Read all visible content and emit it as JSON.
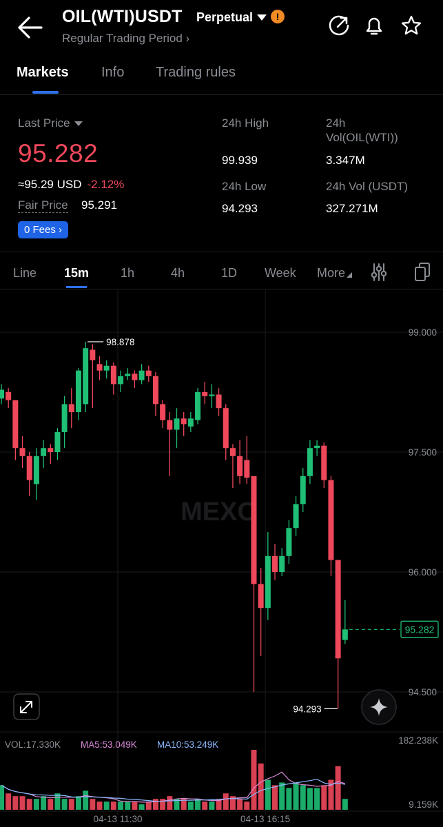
{
  "header": {
    "title": "OIL(WTI)USDT",
    "contract_type": "Perpetual",
    "warning_symbol": "!",
    "subtitle": "Regular Trading Period ›"
  },
  "tabs": [
    "Markets",
    "Info",
    "Trading rules"
  ],
  "stats": {
    "last_price_label": "Last Price",
    "last_price": "95.282",
    "approx_usd": "≈95.29 USD",
    "change_pct": "-2.12%",
    "fair_price_label": "Fair Price",
    "fair_price": "95.291",
    "fees_label": "0 Fees ›",
    "high_label": "24h High",
    "high": "99.939",
    "low_label": "24h Low",
    "low": "94.293",
    "vol_base_label_1": "24h",
    "vol_base_label_2": "Vol(OIL(WTI))",
    "vol_base": "3.347M",
    "vol_usdt_label": "24h Vol (USDT)",
    "vol_usdt": "327.271M"
  },
  "intervals": [
    "Line",
    "15m",
    "1h",
    "4h",
    "1D",
    "Week",
    "More"
  ],
  "colors": {
    "up": "#1fbf75",
    "down": "#f0485b",
    "accent": "#2f6fe8",
    "ma5": "#d98ad8",
    "ma10": "#8ab8ff"
  },
  "chart_data": {
    "type": "candlestick",
    "watermark": "MEXC",
    "price_axis": [
      "99.000",
      "97.500",
      "96.000",
      "94.500"
    ],
    "ylim": [
      93.6,
      99.6
    ],
    "current_price": "95.282",
    "max_label": "98.878",
    "min_label": "94.293",
    "time_labels": [
      "04-13 11:30",
      "04-13 16:15"
    ],
    "volume": {
      "label": "VOL:17.330K",
      "ma5_label": "MA5:53.049K",
      "ma10_label": "MA10:53.249K",
      "max_label": "182.238K",
      "min_label": "9.159K"
    },
    "candles": [
      {
        "o": 98.17,
        "c": 98.28,
        "h": 98.35,
        "l": 98.1
      },
      {
        "o": 98.25,
        "c": 98.15,
        "h": 98.3,
        "l": 98.05
      },
      {
        "o": 98.15,
        "c": 97.55,
        "h": 98.15,
        "l": 97.4
      },
      {
        "o": 97.55,
        "c": 97.45,
        "h": 97.7,
        "l": 97.3
      },
      {
        "o": 97.45,
        "c": 97.15,
        "h": 97.5,
        "l": 96.95
      },
      {
        "o": 97.1,
        "c": 97.45,
        "h": 97.55,
        "l": 96.9
      },
      {
        "o": 97.45,
        "c": 97.55,
        "h": 97.65,
        "l": 97.3
      },
      {
        "o": 97.55,
        "c": 97.5,
        "h": 97.6,
        "l": 97.35
      },
      {
        "o": 97.5,
        "c": 97.75,
        "h": 97.8,
        "l": 97.4
      },
      {
        "o": 97.75,
        "c": 98.1,
        "h": 98.2,
        "l": 97.55
      },
      {
        "o": 98.1,
        "c": 98.0,
        "h": 98.3,
        "l": 97.8
      },
      {
        "o": 98.0,
        "c": 98.52,
        "h": 98.55,
        "l": 97.9
      },
      {
        "o": 98.1,
        "c": 98.8,
        "h": 98.88,
        "l": 98.0
      },
      {
        "o": 98.78,
        "c": 98.65,
        "h": 98.85,
        "l": 98.05
      },
      {
        "o": 98.6,
        "c": 98.52,
        "h": 98.7,
        "l": 98.4
      },
      {
        "o": 98.52,
        "c": 98.58,
        "h": 98.65,
        "l": 98.42
      },
      {
        "o": 98.58,
        "c": 98.35,
        "h": 98.62,
        "l": 98.22
      },
      {
        "o": 98.35,
        "c": 98.45,
        "h": 98.52,
        "l": 98.25
      },
      {
        "o": 98.45,
        "c": 98.48,
        "h": 98.55,
        "l": 98.4
      },
      {
        "o": 98.48,
        "c": 98.4,
        "h": 98.52,
        "l": 98.3
      },
      {
        "o": 98.4,
        "c": 98.52,
        "h": 98.6,
        "l": 98.35
      },
      {
        "o": 98.52,
        "c": 98.45,
        "h": 98.58,
        "l": 98.38
      },
      {
        "o": 98.45,
        "c": 98.1,
        "h": 98.5,
        "l": 97.95
      },
      {
        "o": 98.1,
        "c": 97.9,
        "h": 98.15,
        "l": 97.8
      },
      {
        "o": 97.9,
        "c": 97.78,
        "h": 98.0,
        "l": 97.2
      },
      {
        "o": 97.78,
        "c": 97.92,
        "h": 98.05,
        "l": 97.55
      },
      {
        "o": 97.92,
        "c": 97.85,
        "h": 98.0,
        "l": 97.7
      },
      {
        "o": 97.82,
        "c": 97.92,
        "h": 98.0,
        "l": 97.75
      },
      {
        "o": 97.9,
        "c": 98.25,
        "h": 98.3,
        "l": 97.85
      },
      {
        "o": 98.25,
        "c": 98.2,
        "h": 98.38,
        "l": 98.1
      },
      {
        "o": 98.2,
        "c": 98.22,
        "h": 98.35,
        "l": 98.05
      },
      {
        "o": 98.22,
        "c": 98.05,
        "h": 98.3,
        "l": 97.95
      },
      {
        "o": 98.05,
        "c": 97.55,
        "h": 98.1,
        "l": 97.4
      },
      {
        "o": 97.55,
        "c": 97.45,
        "h": 97.6,
        "l": 97.05
      },
      {
        "o": 97.45,
        "c": 97.2,
        "h": 97.65,
        "l": 97.1
      },
      {
        "o": 97.4,
        "c": 97.18,
        "h": 97.7,
        "l": 97.1
      },
      {
        "o": 97.2,
        "c": 95.85,
        "h": 97.2,
        "l": 94.5
      },
      {
        "o": 95.85,
        "c": 95.55,
        "h": 96.05,
        "l": 94.95
      },
      {
        "o": 95.55,
        "c": 96.2,
        "h": 96.5,
        "l": 95.4
      },
      {
        "o": 96.2,
        "c": 96.0,
        "h": 96.35,
        "l": 95.9
      },
      {
        "o": 96.0,
        "c": 96.2,
        "h": 96.3,
        "l": 95.95
      },
      {
        "o": 96.2,
        "c": 96.55,
        "h": 96.65,
        "l": 96.1
      },
      {
        "o": 96.55,
        "c": 96.85,
        "h": 96.95,
        "l": 96.45
      },
      {
        "o": 96.85,
        "c": 97.2,
        "h": 97.3,
        "l": 96.75
      },
      {
        "o": 97.2,
        "c": 97.55,
        "h": 97.65,
        "l": 97.1
      },
      {
        "o": 97.55,
        "c": 97.58,
        "h": 97.65,
        "l": 97.45
      },
      {
        "o": 97.58,
        "c": 97.15,
        "h": 97.62,
        "l": 97.05
      },
      {
        "o": 97.15,
        "c": 96.15,
        "h": 97.2,
        "l": 95.95
      },
      {
        "o": 96.15,
        "c": 94.92,
        "h": 96.15,
        "l": 94.29
      },
      {
        "o": 95.15,
        "c": 95.282,
        "h": 95.65,
        "l": 95.1
      }
    ],
    "volumes": [
      9,
      6,
      5,
      5,
      4,
      4,
      5,
      4,
      6,
      4,
      4,
      5,
      7,
      4,
      3,
      3,
      3,
      3,
      3,
      3,
      2,
      3,
      4,
      4,
      5,
      4,
      4,
      3,
      4,
      3,
      3,
      4,
      6,
      5,
      4,
      3,
      22,
      17,
      11,
      9,
      10,
      8,
      10,
      9,
      8,
      8,
      9,
      11,
      16,
      4
    ]
  }
}
